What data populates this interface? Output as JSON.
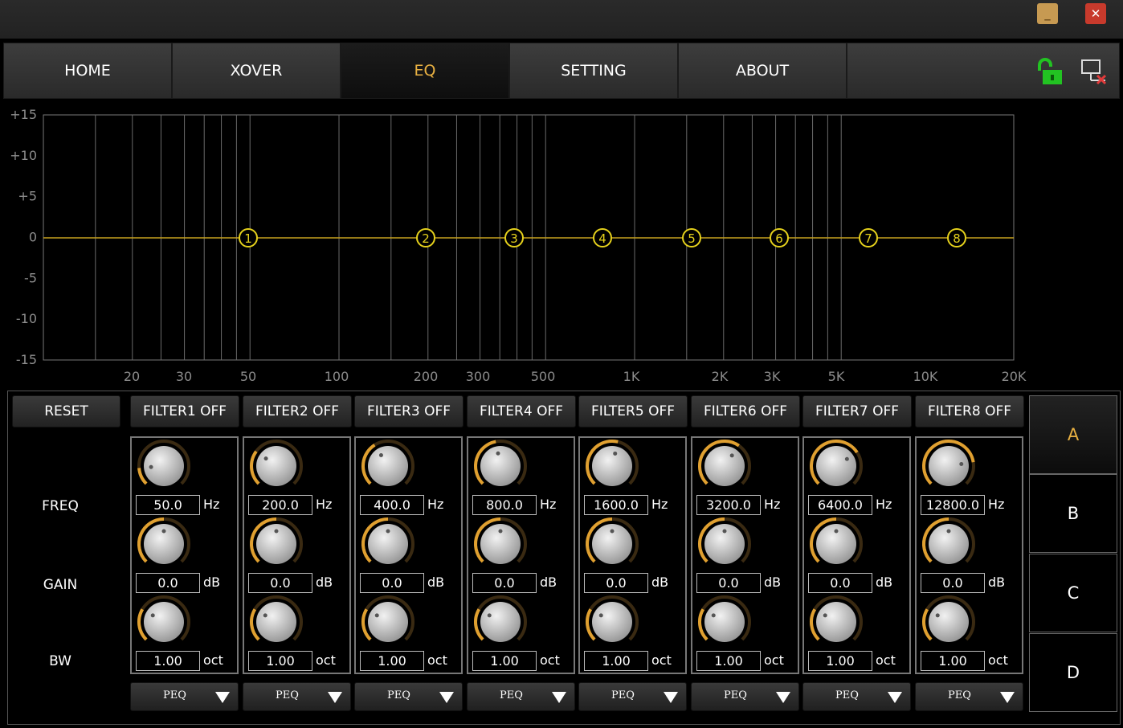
{
  "window": {
    "minimize_glyph": "_",
    "close_glyph": "✕"
  },
  "nav": {
    "tabs": [
      {
        "label": "HOME",
        "active": false
      },
      {
        "label": "XOVER",
        "active": false
      },
      {
        "label": "EQ",
        "active": true
      },
      {
        "label": "SETTING",
        "active": false
      },
      {
        "label": "ABOUT",
        "active": false
      }
    ],
    "icons": [
      "unlock-icon",
      "disconnect-icon"
    ]
  },
  "graph": {
    "y_ticks": [
      "+15",
      "+10",
      "+5",
      "0",
      "-5",
      "-10",
      "-15"
    ],
    "x_ticks": [
      "20",
      "30",
      "50",
      "100",
      "200",
      "300",
      "500",
      "1K",
      "2K",
      "3K",
      "5K",
      "10K",
      "20K"
    ],
    "curve_color": "#c8a21f",
    "marker_color": "#e6d21c",
    "markers": [
      "1",
      "2",
      "3",
      "4",
      "5",
      "6",
      "7",
      "8"
    ]
  },
  "panel": {
    "reset_label": "RESET",
    "row_labels": {
      "freq": "FREQ",
      "gain": "GAIN",
      "bw": "BW"
    },
    "filters": [
      {
        "toggle": "FILTER1 OFF",
        "freq": "50.0",
        "freq_unit": "Hz",
        "gain": "0.0",
        "gain_unit": "dB",
        "bw": "1.00",
        "bw_unit": "oct",
        "type": "PEQ",
        "freq_level": 0.15,
        "gain_level": 0.5,
        "bw_level": 0.28
      },
      {
        "toggle": "FILTER2 OFF",
        "freq": "200.0",
        "freq_unit": "Hz",
        "gain": "0.0",
        "gain_unit": "dB",
        "bw": "1.00",
        "bw_unit": "oct",
        "type": "PEQ",
        "freq_level": 0.3,
        "gain_level": 0.5,
        "bw_level": 0.28
      },
      {
        "toggle": "FILTER3 OFF",
        "freq": "400.0",
        "freq_unit": "Hz",
        "gain": "0.0",
        "gain_unit": "dB",
        "bw": "1.00",
        "bw_unit": "oct",
        "type": "PEQ",
        "freq_level": 0.38,
        "gain_level": 0.5,
        "bw_level": 0.28
      },
      {
        "toggle": "FILTER4 OFF",
        "freq": "800.0",
        "freq_unit": "Hz",
        "gain": "0.0",
        "gain_unit": "dB",
        "bw": "1.00",
        "bw_unit": "oct",
        "type": "PEQ",
        "freq_level": 0.46,
        "gain_level": 0.5,
        "bw_level": 0.28
      },
      {
        "toggle": "FILTER5 OFF",
        "freq": "1600.0",
        "freq_unit": "Hz",
        "gain": "0.0",
        "gain_unit": "dB",
        "bw": "1.00",
        "bw_unit": "oct",
        "type": "PEQ",
        "freq_level": 0.55,
        "gain_level": 0.5,
        "bw_level": 0.28
      },
      {
        "toggle": "FILTER6 OFF",
        "freq": "3200.0",
        "freq_unit": "Hz",
        "gain": "0.0",
        "gain_unit": "dB",
        "bw": "1.00",
        "bw_unit": "oct",
        "type": "PEQ",
        "freq_level": 0.63,
        "gain_level": 0.5,
        "bw_level": 0.28
      },
      {
        "toggle": "FILTER7 OFF",
        "freq": "6400.0",
        "freq_unit": "Hz",
        "gain": "0.0",
        "gain_unit": "dB",
        "bw": "1.00",
        "bw_unit": "oct",
        "type": "PEQ",
        "freq_level": 0.71,
        "gain_level": 0.5,
        "bw_level": 0.28
      },
      {
        "toggle": "FILTER8 OFF",
        "freq": "12800.0",
        "freq_unit": "Hz",
        "gain": "0.0",
        "gain_unit": "dB",
        "bw": "1.00",
        "bw_unit": "oct",
        "type": "PEQ",
        "freq_level": 0.8,
        "gain_level": 0.5,
        "bw_level": 0.28
      }
    ],
    "presets": [
      {
        "label": "A",
        "active": true
      },
      {
        "label": "B",
        "active": false
      },
      {
        "label": "C",
        "active": false
      },
      {
        "label": "D",
        "active": false
      }
    ],
    "knob_arc_color": "#e0a030"
  }
}
